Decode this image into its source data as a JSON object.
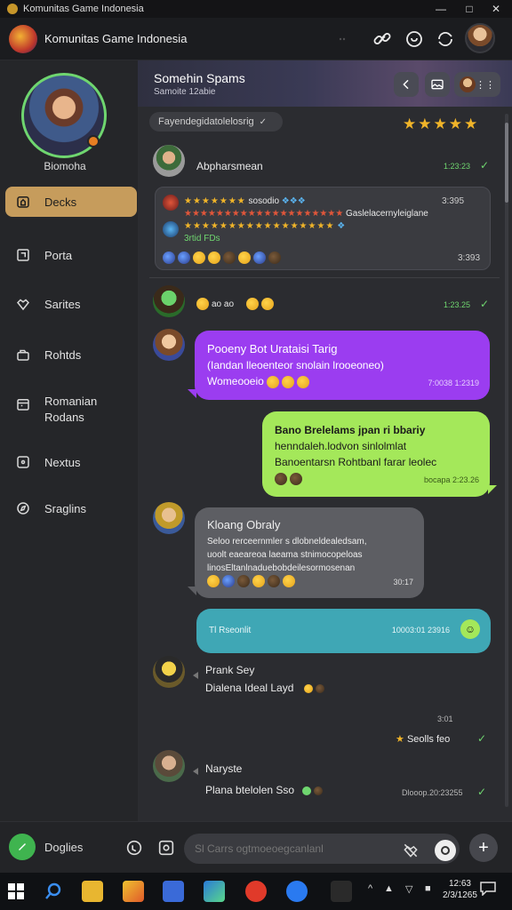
{
  "window": {
    "title": "Komunitas Game Indonesia",
    "controls": [
      "minimize",
      "maximize",
      "close"
    ]
  },
  "app_header": {
    "title": "Komunitas Game Indonesia",
    "icons": [
      "link-icon",
      "notification-icon",
      "refresh-icon",
      "profile-avatar"
    ]
  },
  "sidebar": {
    "username": "Biomoha",
    "items": [
      {
        "label": "Decks",
        "icon": "home-icon",
        "active": true
      },
      {
        "label": "Porta",
        "icon": "square-icon"
      },
      {
        "label": "Sarites",
        "icon": "heart-icon"
      },
      {
        "label": "Rohtds",
        "icon": "bag-icon"
      },
      {
        "label": "Romanian",
        "label2": "Rodans",
        "icon": "calendar-icon"
      },
      {
        "label": "Nextus",
        "icon": "box-icon"
      },
      {
        "label": "Sraglins",
        "icon": "compass-icon"
      }
    ]
  },
  "chat_header": {
    "title": "Somehin Spams",
    "subtitle": "Samoite 12abie"
  },
  "filter": {
    "label": "Fayendegidatolelosrig",
    "icon": "chevron-down-icon"
  },
  "rating": {
    "stars": "★★★★★",
    "value": 5
  },
  "messages": {
    "m1": {
      "sender": "Abpharsmean",
      "time": "1:23:23",
      "embed": {
        "row1_stars": "★★★★★★★",
        "row1_text": "sosodio",
        "row1_time": "3:395",
        "row2_text": "Gaslelacernyleiglane",
        "row3_text": "3rtid FDs",
        "footer_time": "3:393"
      }
    },
    "m2": {
      "time": "1:23.25",
      "emoji_text": "ao  ao"
    },
    "m3": {
      "title": "Pooeny Bot Urataisi Tarig",
      "line2": "(Iandan lleoenteor snolain lrooeoneo)",
      "line3": "Womeooeio",
      "time": "7:0038 1:2319"
    },
    "m4": {
      "line1": "Bano Brelelams jpan ri bbariy",
      "line2": "henndaleh.lodvon sinlolmlat",
      "line3": "Banoentarsn Rohtbanl farar leolec",
      "time": "bocapa 2:23.26"
    },
    "m5": {
      "title": "Kloang Obraly",
      "line1": "Seloo rerceernmler s dlobneldealedsam,",
      "line2": "uoolt eaeareoa laeama stnimocopeloas",
      "line3": "linosEltanlnaduebobdeilesormosenan",
      "time": "30:17"
    },
    "m6": {
      "text": "Tl Rseonlit",
      "time": "10003:01 23916"
    },
    "m7": {
      "sender": "Prank Sey",
      "text": "Dialena Ideal Layd"
    },
    "m8": {
      "label": "3:01",
      "text": "Seolls feo"
    },
    "m9": {
      "sender": "Naryste",
      "text": "Plana btelolen Sso",
      "time": "Dlooop.20:23255"
    }
  },
  "composer": {
    "status_label": "Doglies",
    "placeholder": "Sl Carrs ogtmoeoegcanlanl"
  },
  "taskbar": {
    "clock_time": "12:63",
    "clock_date": "2/3/1265"
  },
  "colors": {
    "accent": "#c69c5c",
    "purple_bubble": "#9b3df0",
    "green_bubble": "#a4e85a",
    "gray_bubble": "#5d5e63",
    "teal_bubble": "#3fa7b5",
    "online": "#6fd66f"
  }
}
